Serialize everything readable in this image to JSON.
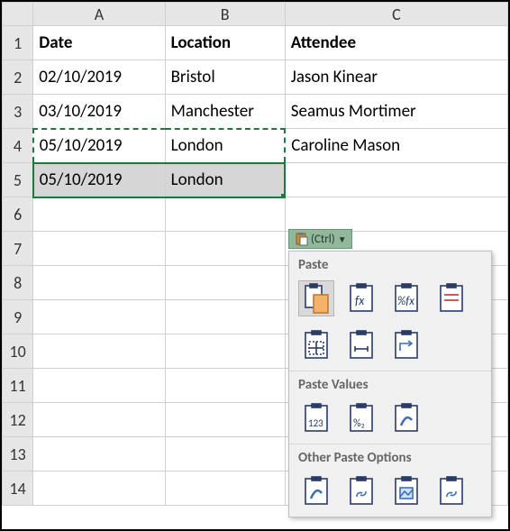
{
  "columns": [
    "A",
    "B",
    "C"
  ],
  "rows": [
    "1",
    "2",
    "3",
    "4",
    "5",
    "6",
    "7",
    "8",
    "9",
    "10",
    "11",
    "12",
    "13",
    "14"
  ],
  "headers": {
    "a": "Date",
    "b": "Location",
    "c": "Attendee"
  },
  "data": {
    "r2": {
      "a": "02/10/2019",
      "b": "Bristol",
      "c": "Jason Kinear"
    },
    "r3": {
      "a": "03/10/2019",
      "b": "Manchester",
      "c": "Seamus Mortimer"
    },
    "r4": {
      "a": "05/10/2019",
      "b": "London",
      "c": "Caroline Mason"
    },
    "r5": {
      "a": "05/10/2019",
      "b": "London"
    }
  },
  "paste_button": {
    "label": "(Ctrl)"
  },
  "paste_menu": {
    "section1": "Paste",
    "section2": "Paste Values",
    "section3": "Other Paste Options"
  }
}
